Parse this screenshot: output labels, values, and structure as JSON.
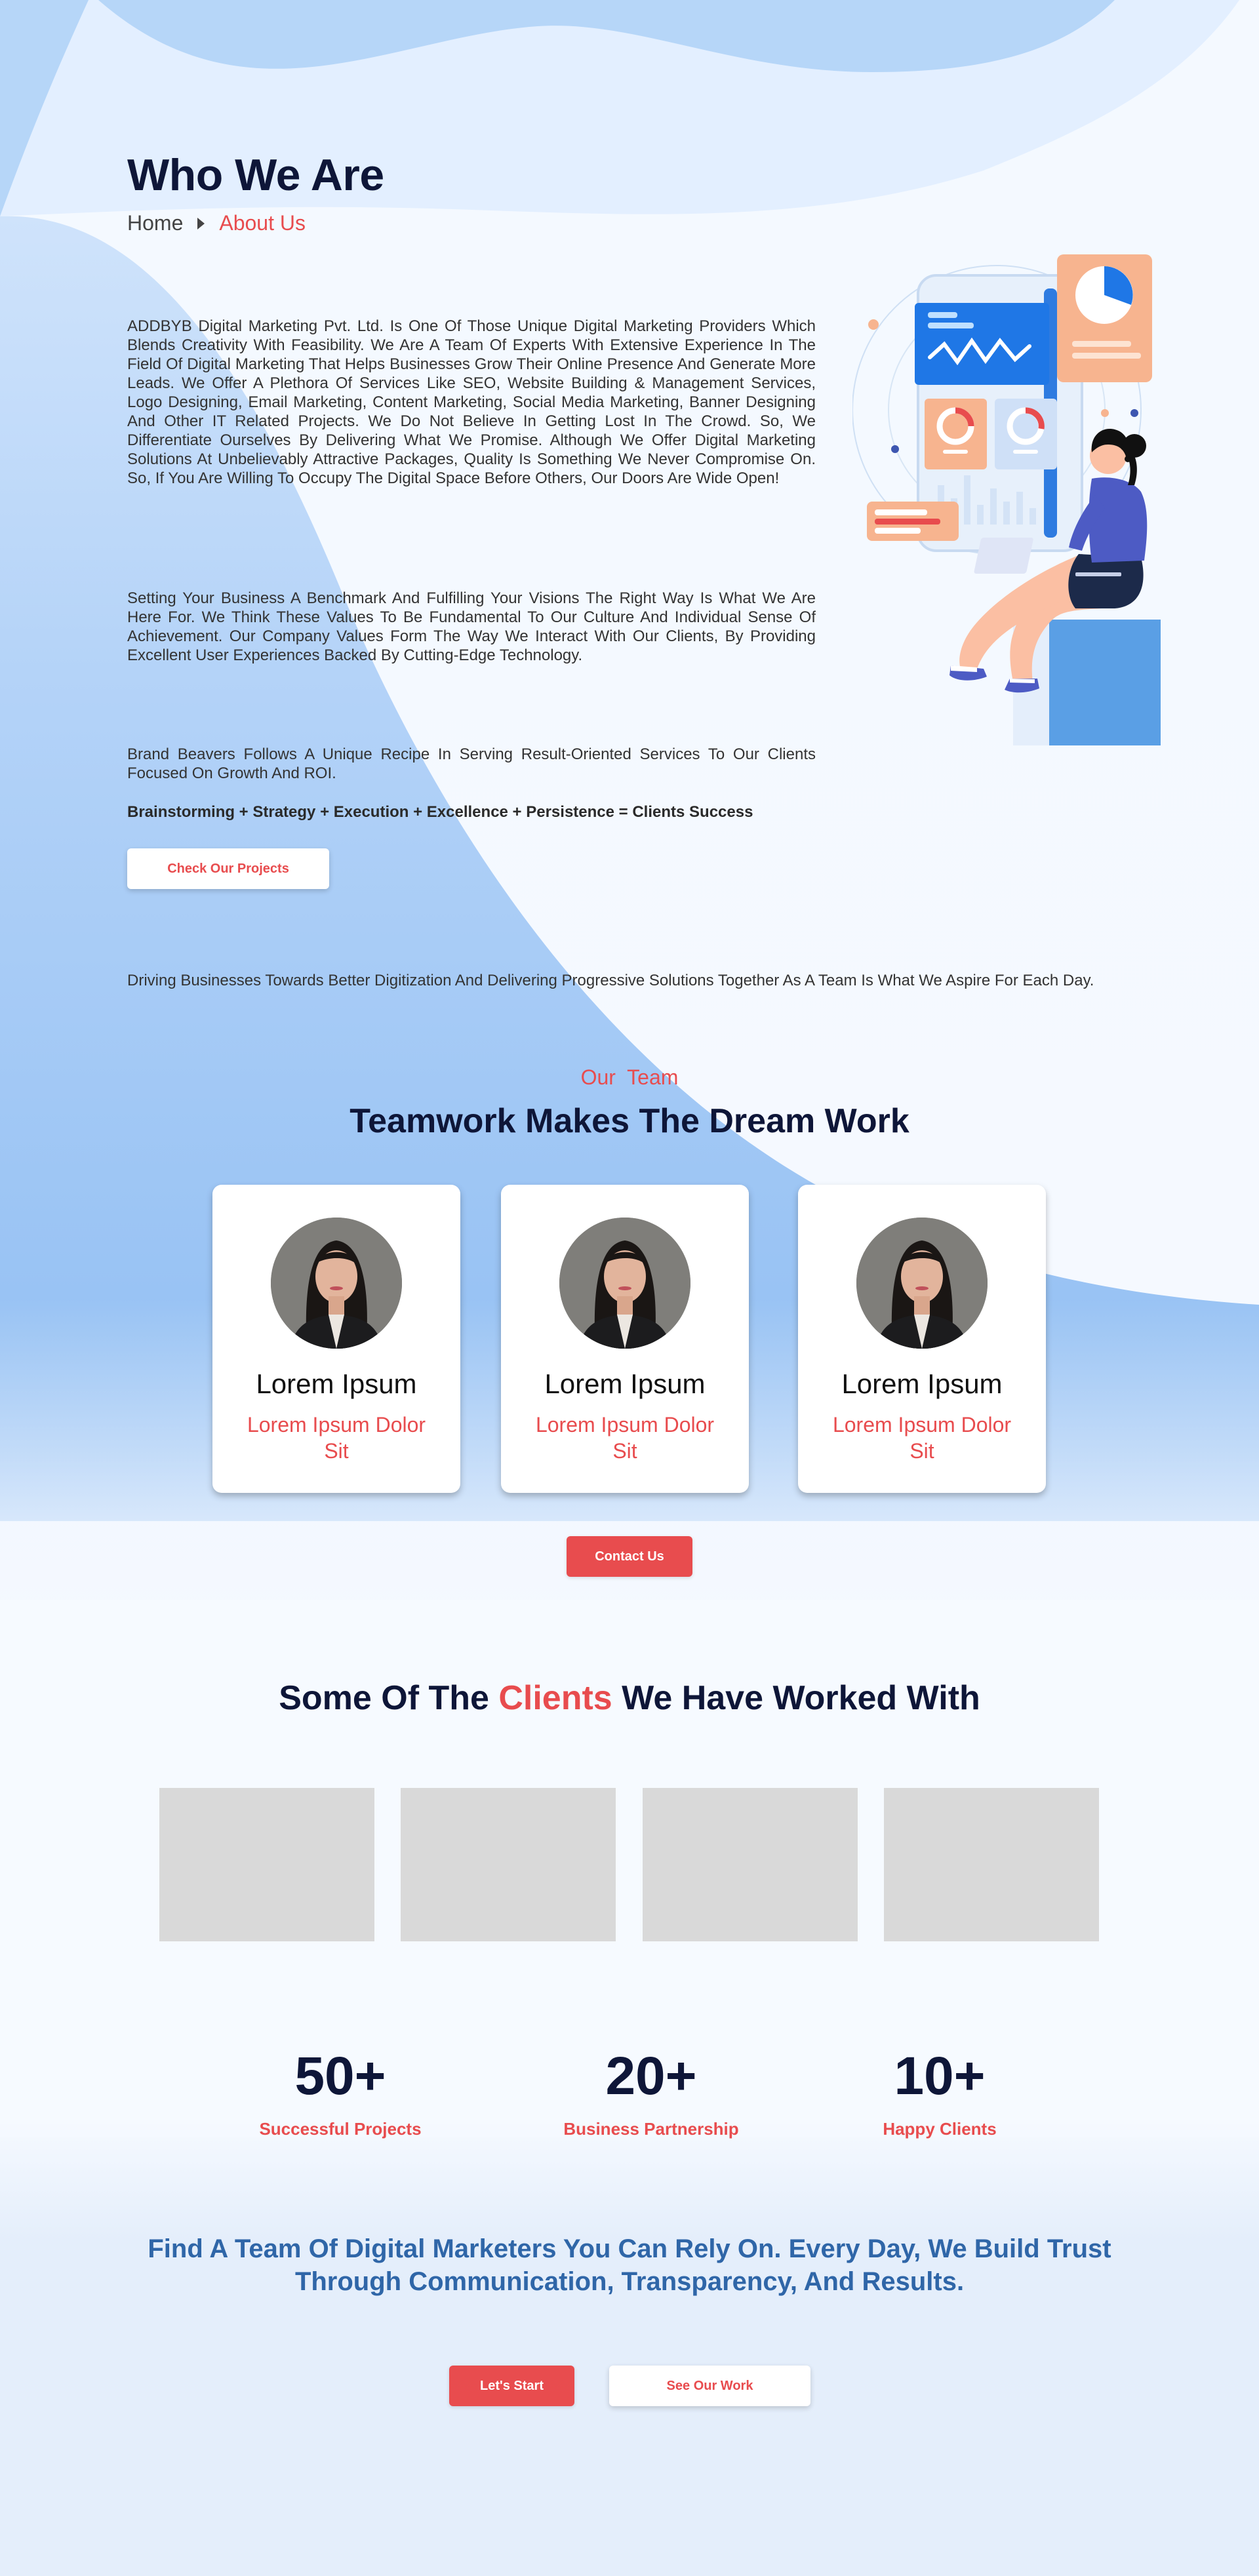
{
  "hero": {
    "title": "Who We Are",
    "breadcrumb": {
      "home": "Home",
      "current": "About Us"
    }
  },
  "about": {
    "p1": "ADDBYB Digital Marketing Pvt. Ltd. Is One Of Those Unique Digital Marketing Providers Which Blends Creativity With Feasibility. We Are A Team Of Experts With Extensive Experience In The Field Of Digital Marketing That Helps Businesses Grow Their Online Presence And Generate More Leads. We Offer A Plethora Of Services Like SEO, Website Building & Management Services, Logo Designing, Email Marketing, Content Marketing, Social Media Marketing, Banner Designing And Other IT Related Projects. We Do Not Believe In Getting Lost In The Crowd. So, We Differentiate Ourselves By Delivering What We Promise. Although We Offer Digital Marketing Solutions At Unbelievably Attractive Packages, Quality Is Something We Never Compromise On. So, If You Are Willing To Occupy The Digital Space Before Others, Our Doors Are Wide Open!",
    "p2": "Setting Your Business A Benchmark And Fulfilling Your Visions The Right Way Is What We Are Here For. We Think These Values To Be Fundamental To Our Culture And Individual Sense Of Achievement. Our Company Values Form The Way We Interact With Our Clients, By Providing Excellent User Experiences Backed By Cutting-Edge Technology.",
    "p3": "Brand Beavers Follows A Unique Recipe In Serving Result-Oriented Services To Our Clients Focused On Growth And ROI.",
    "formula": "Brainstorming + Strategy + Execution + Excellence + Persistence = Clients Success",
    "projects_button": "Check Our Projects",
    "aspire": "Driving Businesses Towards Better Digitization And Delivering Progressive Solutions Together As A Team Is What We Aspire For Each Day."
  },
  "team": {
    "eyebrow": "Our  Team",
    "heading": "Teamwork Makes The Dream Work",
    "members": [
      {
        "name": "Lorem Ipsum",
        "role": "Lorem Ipsum Dolor Sit"
      },
      {
        "name": "Lorem Ipsum",
        "role": "Lorem Ipsum Dolor Sit"
      },
      {
        "name": "Lorem Ipsum",
        "role": "Lorem Ipsum Dolor Sit"
      }
    ],
    "contact_button": "Contact Us"
  },
  "clients": {
    "heading_pre": "Some Of The ",
    "heading_accent": "Clients",
    "heading_post": " We Have Worked With"
  },
  "stats": [
    {
      "value": "50+",
      "label": "Successful Projects"
    },
    {
      "value": "20+",
      "label": "Business Partnership"
    },
    {
      "value": "10+",
      "label": "Happy Clients"
    }
  ],
  "cta": {
    "heading": "Find A Team Of Digital Marketers You Can Rely On. Every Day, We Build Trust Through Communication, Transparency, And Results.",
    "start_button": "Let's Start",
    "work_button": "See Our Work"
  },
  "colors": {
    "navy": "#0e1638",
    "accent_red": "#e84c4e",
    "cta_blue": "#2f66a8",
    "sky": "#a8cdf7"
  }
}
